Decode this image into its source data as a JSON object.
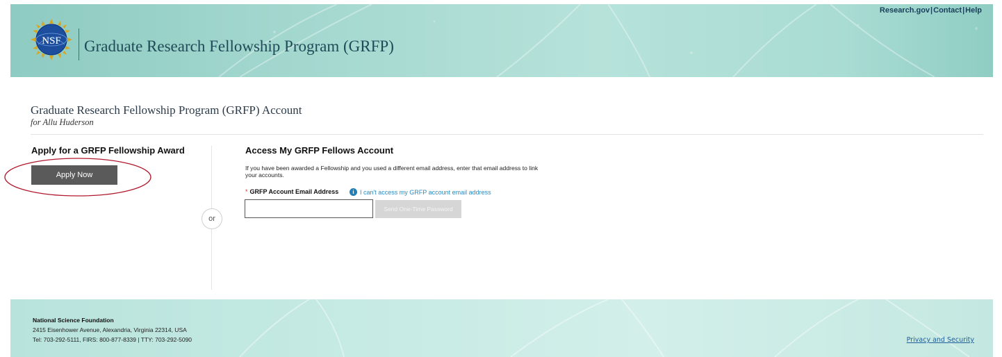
{
  "header": {
    "logo_text": "NSF",
    "site_title": "Graduate Research Fellowship Program (GRFP)",
    "top_links": [
      "Research.gov",
      "Contact",
      "Help"
    ],
    "top_link_separator": "|"
  },
  "page": {
    "title": "Graduate Research Fellowship Program (GRFP) Account",
    "subtitle": "for Allu Huderson"
  },
  "left_panel": {
    "heading": "Apply for a GRFP Fellowship Award",
    "apply_button": "Apply Now"
  },
  "divider": {
    "or_label": "or"
  },
  "right_panel": {
    "heading": "Access My GRFP Fellows Account",
    "description": "If you have been awarded a Fellowship and you used a different email address, enter that email address to link your accounts.",
    "required_marker": "*",
    "email_label": "GRFP Account Email Address",
    "info_icon_glyph": "i",
    "help_link": "I can't access my GRFP account email address",
    "email_value": "",
    "otp_button": "Send One-Time Password"
  },
  "footer": {
    "org_name": "National Science Foundation",
    "address": "2415 Eisenhower Avenue, Alexandria, Virginia 22314, USA",
    "phones": "Tel: 703-292-5111, FIRS: 800-877-8339 | TTY: 703-292-5090",
    "privacy_link": "Privacy and Security"
  },
  "colors": {
    "header_teal": "#a4d8cf",
    "apply_button": "#5a5a5a",
    "highlight_ellipse": "#b0182b",
    "link_blue": "#2a8ac2",
    "disabled_button": "#d6d6d6"
  },
  "icons": {
    "logo": "nsf-seal-logo",
    "info": "info-circle-icon"
  }
}
